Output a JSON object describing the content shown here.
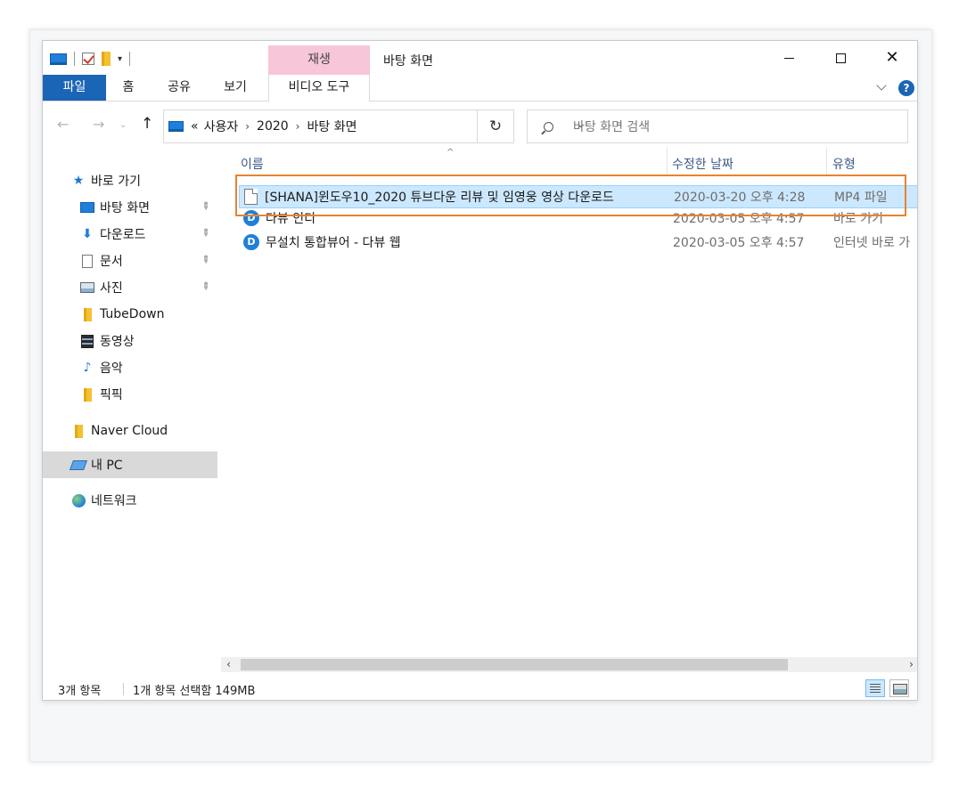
{
  "window": {
    "title": "바탕 화면",
    "context_tab_group": "재생"
  },
  "ribbon": {
    "tabs": [
      "파일",
      "홈",
      "공유",
      "보기",
      "비디오 도구"
    ],
    "help_label": "?"
  },
  "window_buttons": {
    "close_glyph": "✕"
  },
  "nav": {
    "back": "←",
    "forward": "→",
    "recent": "⌄",
    "up": "↑",
    "refresh": "↻",
    "breadcrumb_overflow": "«",
    "breadcrumb": [
      "사용자",
      "2020",
      "바탕 화면"
    ],
    "crumb_sep": "›",
    "address_dropdown": "⌄",
    "search_placeholder": "바탕 화면 검색"
  },
  "sidebar": {
    "quick_access": "바로 가기",
    "items": [
      {
        "label": "바탕 화면",
        "icon": "desktop-icon",
        "pinned": true
      },
      {
        "label": "다운로드",
        "icon": "download-icon",
        "pinned": true
      },
      {
        "label": "문서",
        "icon": "document-icon",
        "pinned": true
      },
      {
        "label": "사진",
        "icon": "pictures-icon",
        "pinned": true
      },
      {
        "label": "TubeDown",
        "icon": "folder-icon",
        "pinned": false
      },
      {
        "label": "동영상",
        "icon": "video-icon",
        "pinned": false
      },
      {
        "label": "음악",
        "icon": "music-icon",
        "pinned": false
      },
      {
        "label": "픽픽",
        "icon": "folder-icon",
        "pinned": false
      }
    ],
    "naver_cloud": "Naver Cloud",
    "this_pc": "내 PC",
    "network": "네트워크",
    "pin_glyph": "📌"
  },
  "columns": {
    "name": "이름",
    "date": "수정한 날짜",
    "type": "유형",
    "sort_indicator": "^"
  },
  "files": [
    {
      "name": "[SHANA]윈도우10_2020 튜브다운 리뷰 및 임영웅 영상 다운로드",
      "date": "2020-03-20 오후 4:28",
      "type": "MP4 파일",
      "icon": "file-icon",
      "selected": true
    },
    {
      "name": "다뷰 인디",
      "date": "2020-03-05 오후 4:57",
      "type": "바로 가기",
      "icon": "daview-shortcut-icon",
      "selected": false
    },
    {
      "name": "무설치 통합뷰어 - 다뷰 웹",
      "date": "2020-03-05 오후 4:57",
      "type": "인터넷 바로 가",
      "icon": "daview-shortcut-icon",
      "selected": false
    }
  ],
  "status": {
    "item_count": "3개 항목",
    "selection": "1개 항목 선택함 149MB"
  },
  "colors": {
    "accent": "#1a65b6",
    "context_tab": "#f7c6d8",
    "selection": "#cce8ff",
    "highlight_box": "#e8832f"
  }
}
